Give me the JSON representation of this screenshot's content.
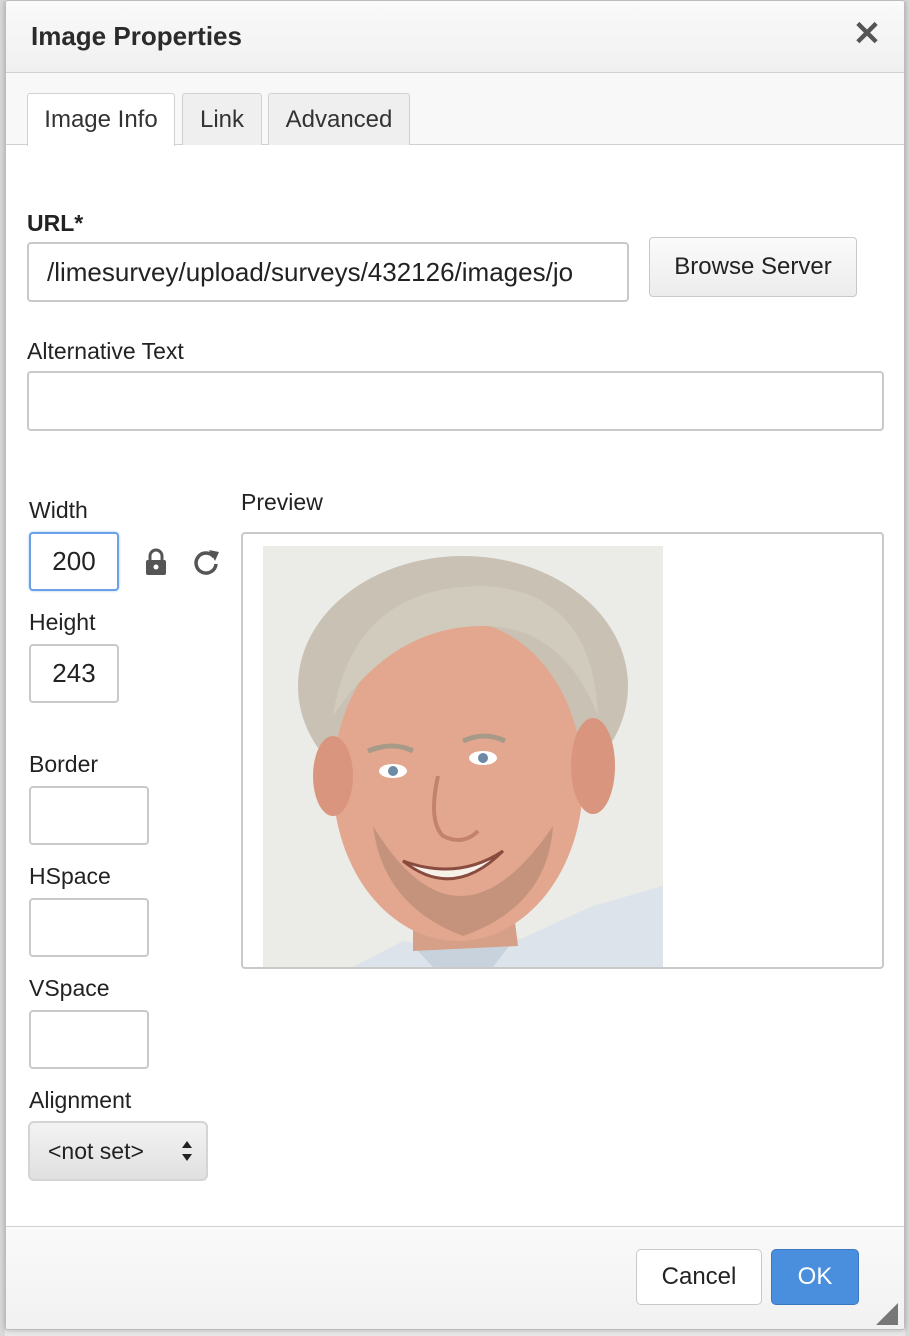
{
  "dialog": {
    "title": "Image Properties",
    "close_label": "✕"
  },
  "tabs": [
    {
      "label": "Image Info",
      "active": true
    },
    {
      "label": "Link",
      "active": false
    },
    {
      "label": "Advanced",
      "active": false
    }
  ],
  "form": {
    "url_label": "URL*",
    "url_value": "/limesurvey/upload/surveys/432126/images/jo",
    "browse_label": "Browse Server",
    "alt_label": "Alternative Text",
    "alt_value": "",
    "width_label": "Width",
    "width_value": "200",
    "height_label": "Height",
    "height_value": "243",
    "border_label": "Border",
    "border_value": "",
    "hspace_label": "HSpace",
    "hspace_value": "",
    "vspace_label": "VSpace",
    "vspace_value": "",
    "alignment_label": "Alignment",
    "alignment_value": "<not set>",
    "preview_label": "Preview"
  },
  "footer": {
    "cancel_label": "Cancel",
    "ok_label": "OK"
  },
  "colors": {
    "ok_button": "#4a8fde",
    "focus_border": "#6aa1e6"
  },
  "icons": {
    "lock": "lock-icon",
    "reset": "reset-size-icon",
    "close": "close-icon"
  }
}
